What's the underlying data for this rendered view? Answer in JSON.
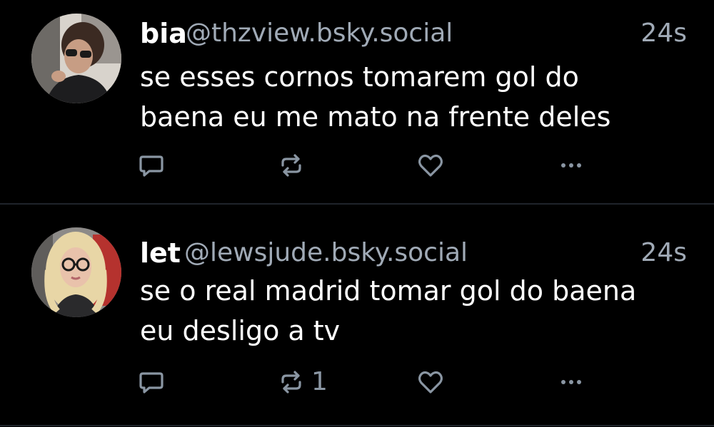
{
  "posts": [
    {
      "author_name": "bia",
      "handle": "@thzview.bsky.social",
      "time": "24s",
      "text_lines": [
        "se esses cornos tomarem gol do",
        "baena eu me mato na frente deles"
      ],
      "repost_count": "",
      "icons": [
        "reply-icon",
        "repost-icon",
        "like-icon",
        "more-icon"
      ]
    },
    {
      "author_name": "let",
      "handle": "@lewsjude.bsky.social",
      "time": "24s",
      "text_lines": [
        "se o real madrid tomar gol do baena",
        "eu desligo a tv"
      ],
      "repost_count": "1",
      "icons": [
        "reply-icon",
        "repost-icon",
        "like-icon",
        "more-icon"
      ]
    }
  ],
  "colors": {
    "background": "#000000",
    "text_primary": "#ffffff",
    "text_secondary": "#a0aab6",
    "icon": "#8a96a3",
    "divider": "#1f242b"
  }
}
